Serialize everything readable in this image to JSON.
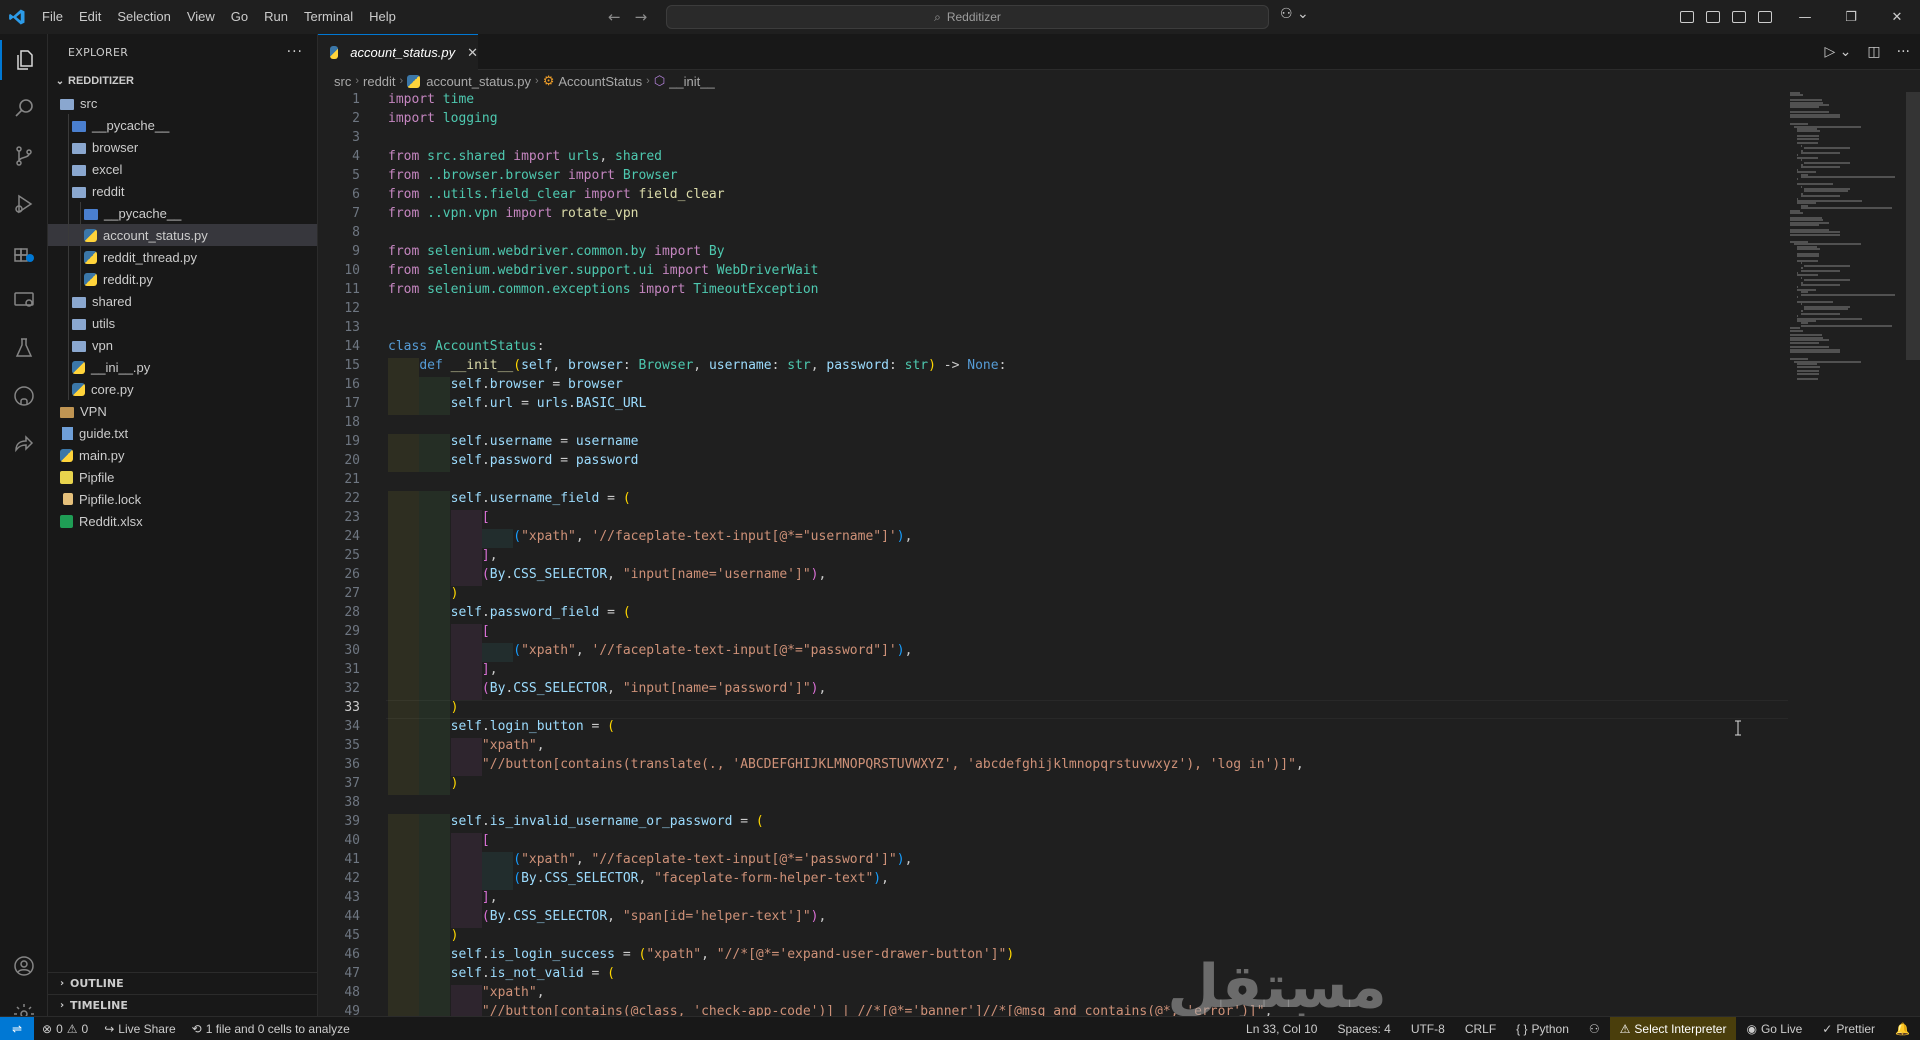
{
  "menu": [
    "File",
    "Edit",
    "Selection",
    "View",
    "Go",
    "Run",
    "Terminal",
    "Help"
  ],
  "command_center": "Redditizer",
  "explorer": {
    "title": "EXPLORER",
    "root": "REDDITIZER",
    "items": [
      {
        "label": "src",
        "depth": 0,
        "type": "folder-open"
      },
      {
        "label": "__pycache__",
        "depth": 1,
        "type": "folder-py"
      },
      {
        "label": "browser",
        "depth": 1,
        "type": "folder"
      },
      {
        "label": "excel",
        "depth": 1,
        "type": "folder"
      },
      {
        "label": "reddit",
        "depth": 1,
        "type": "folder-open"
      },
      {
        "label": "__pycache__",
        "depth": 2,
        "type": "folder-py"
      },
      {
        "label": "account_status.py",
        "depth": 2,
        "type": "py",
        "selected": true
      },
      {
        "label": "reddit_thread.py",
        "depth": 2,
        "type": "py"
      },
      {
        "label": "reddit.py",
        "depth": 2,
        "type": "py"
      },
      {
        "label": "shared",
        "depth": 1,
        "type": "folder"
      },
      {
        "label": "utils",
        "depth": 1,
        "type": "folder"
      },
      {
        "label": "vpn",
        "depth": 1,
        "type": "folder"
      },
      {
        "label": "__ini__.py",
        "depth": 1,
        "type": "py"
      },
      {
        "label": "core.py",
        "depth": 1,
        "type": "py"
      },
      {
        "label": "VPN",
        "depth": 0,
        "type": "folder-closed"
      },
      {
        "label": "guide.txt",
        "depth": 0,
        "type": "txt"
      },
      {
        "label": "main.py",
        "depth": 0,
        "type": "py"
      },
      {
        "label": "Pipfile",
        "depth": 0,
        "type": "pip"
      },
      {
        "label": "Pipfile.lock",
        "depth": 0,
        "type": "lock"
      },
      {
        "label": "Reddit.xlsx",
        "depth": 0,
        "type": "xlsx"
      }
    ],
    "outline": "OUTLINE",
    "timeline": "TIMELINE"
  },
  "tab": {
    "label": "account_status.py"
  },
  "breadcrumbs": [
    "src",
    "reddit",
    "account_status.py",
    "AccountStatus",
    "__init__"
  ],
  "editor": {
    "current_line": 33,
    "lines": [
      [
        [
          "k",
          "import"
        ],
        [
          "p",
          " "
        ],
        [
          "c",
          "time"
        ]
      ],
      [
        [
          "k",
          "import"
        ],
        [
          "p",
          " "
        ],
        [
          "c",
          "logging"
        ]
      ],
      [],
      [
        [
          "k",
          "from"
        ],
        [
          "p",
          " "
        ],
        [
          "c",
          "src.shared"
        ],
        [
          "p",
          " "
        ],
        [
          "k",
          "import"
        ],
        [
          "p",
          " "
        ],
        [
          "c",
          "urls"
        ],
        [
          "p",
          ", "
        ],
        [
          "c",
          "shared"
        ]
      ],
      [
        [
          "k",
          "from"
        ],
        [
          "p",
          " "
        ],
        [
          "c",
          "..browser.browser"
        ],
        [
          "p",
          " "
        ],
        [
          "k",
          "import"
        ],
        [
          "p",
          " "
        ],
        [
          "c",
          "Browser"
        ]
      ],
      [
        [
          "k",
          "from"
        ],
        [
          "p",
          " "
        ],
        [
          "c",
          "..utils.field_clear"
        ],
        [
          "p",
          " "
        ],
        [
          "k",
          "import"
        ],
        [
          "p",
          " "
        ],
        [
          "f",
          "field_clear"
        ]
      ],
      [
        [
          "k",
          "from"
        ],
        [
          "p",
          " "
        ],
        [
          "c",
          "..vpn.vpn"
        ],
        [
          "p",
          " "
        ],
        [
          "k",
          "import"
        ],
        [
          "p",
          " "
        ],
        [
          "f",
          "rotate_vpn"
        ]
      ],
      [],
      [
        [
          "k",
          "from"
        ],
        [
          "p",
          " "
        ],
        [
          "c",
          "selenium.webdriver.common.by"
        ],
        [
          "p",
          " "
        ],
        [
          "k",
          "import"
        ],
        [
          "p",
          " "
        ],
        [
          "c",
          "By"
        ]
      ],
      [
        [
          "k",
          "from"
        ],
        [
          "p",
          " "
        ],
        [
          "c",
          "selenium.webdriver.support.ui"
        ],
        [
          "p",
          " "
        ],
        [
          "k",
          "import"
        ],
        [
          "p",
          " "
        ],
        [
          "c",
          "WebDriverWait"
        ]
      ],
      [
        [
          "k",
          "from"
        ],
        [
          "p",
          " "
        ],
        [
          "c",
          "selenium.common.exceptions"
        ],
        [
          "p",
          " "
        ],
        [
          "k",
          "import"
        ],
        [
          "p",
          " "
        ],
        [
          "c",
          "TimeoutException"
        ]
      ],
      [],
      [],
      [
        [
          "kb",
          "class"
        ],
        [
          "p",
          " "
        ],
        [
          "c",
          "AccountStatus"
        ],
        [
          "p",
          ":"
        ]
      ],
      [
        [
          "p",
          "    "
        ],
        [
          "kb",
          "def"
        ],
        [
          "p",
          " "
        ],
        [
          "f",
          "__init__"
        ],
        [
          "br1",
          "("
        ],
        [
          "n",
          "self"
        ],
        [
          "p",
          ", "
        ],
        [
          "n",
          "browser"
        ],
        [
          "p",
          ": "
        ],
        [
          "c",
          "Browser"
        ],
        [
          "p",
          ", "
        ],
        [
          "n",
          "username"
        ],
        [
          "p",
          ": "
        ],
        [
          "c",
          "str"
        ],
        [
          "p",
          ", "
        ],
        [
          "n",
          "password"
        ],
        [
          "p",
          ": "
        ],
        [
          "c",
          "str"
        ],
        [
          "br1",
          ")"
        ],
        [
          "p",
          " -> "
        ],
        [
          "kb",
          "None"
        ],
        [
          "p",
          ":"
        ]
      ],
      [
        [
          "p",
          "        "
        ],
        [
          "n",
          "self"
        ],
        [
          "p",
          "."
        ],
        [
          "n",
          "browser"
        ],
        [
          "p",
          " = "
        ],
        [
          "n",
          "browser"
        ]
      ],
      [
        [
          "p",
          "        "
        ],
        [
          "n",
          "self"
        ],
        [
          "p",
          "."
        ],
        [
          "n",
          "url"
        ],
        [
          "p",
          " = "
        ],
        [
          "n",
          "urls"
        ],
        [
          "p",
          "."
        ],
        [
          "n",
          "BASIC_URL"
        ]
      ],
      [],
      [
        [
          "p",
          "        "
        ],
        [
          "n",
          "self"
        ],
        [
          "p",
          "."
        ],
        [
          "n",
          "username"
        ],
        [
          "p",
          " = "
        ],
        [
          "n",
          "username"
        ]
      ],
      [
        [
          "p",
          "        "
        ],
        [
          "n",
          "self"
        ],
        [
          "p",
          "."
        ],
        [
          "n",
          "password"
        ],
        [
          "p",
          " = "
        ],
        [
          "n",
          "password"
        ]
      ],
      [],
      [
        [
          "p",
          "        "
        ],
        [
          "n",
          "self"
        ],
        [
          "p",
          "."
        ],
        [
          "n",
          "username_field"
        ],
        [
          "p",
          " = "
        ],
        [
          "br1",
          "("
        ]
      ],
      [
        [
          "p",
          "            "
        ],
        [
          "br2",
          "["
        ]
      ],
      [
        [
          "p",
          "                "
        ],
        [
          "br3",
          "("
        ],
        [
          "s",
          "\"xpath\""
        ],
        [
          "p",
          ", "
        ],
        [
          "s",
          "'//faceplate-text-input[@*=\"username\"]'"
        ],
        [
          "br3",
          ")"
        ],
        [
          "p",
          ","
        ]
      ],
      [
        [
          "p",
          "            "
        ],
        [
          "br2",
          "]"
        ],
        [
          "p",
          ","
        ]
      ],
      [
        [
          "p",
          "            "
        ],
        [
          "br2",
          "("
        ],
        [
          "n",
          "By"
        ],
        [
          "p",
          "."
        ],
        [
          "n",
          "CSS_SELECTOR"
        ],
        [
          "p",
          ", "
        ],
        [
          "s",
          "\"input[name='username']\""
        ],
        [
          "br2",
          ")"
        ],
        [
          "p",
          ","
        ]
      ],
      [
        [
          "p",
          "        "
        ],
        [
          "br1",
          ")"
        ]
      ],
      [
        [
          "p",
          "        "
        ],
        [
          "n",
          "self"
        ],
        [
          "p",
          "."
        ],
        [
          "n",
          "password_field"
        ],
        [
          "p",
          " = "
        ],
        [
          "br1",
          "("
        ]
      ],
      [
        [
          "p",
          "            "
        ],
        [
          "br2",
          "["
        ]
      ],
      [
        [
          "p",
          "                "
        ],
        [
          "br3",
          "("
        ],
        [
          "s",
          "\"xpath\""
        ],
        [
          "p",
          ", "
        ],
        [
          "s",
          "'//faceplate-text-input[@*=\"password\"]'"
        ],
        [
          "br3",
          ")"
        ],
        [
          "p",
          ","
        ]
      ],
      [
        [
          "p",
          "            "
        ],
        [
          "br2",
          "]"
        ],
        [
          "p",
          ","
        ]
      ],
      [
        [
          "p",
          "            "
        ],
        [
          "br2",
          "("
        ],
        [
          "n",
          "By"
        ],
        [
          "p",
          "."
        ],
        [
          "n",
          "CSS_SELECTOR"
        ],
        [
          "p",
          ", "
        ],
        [
          "s",
          "\"input[name='password']\""
        ],
        [
          "br2",
          ")"
        ],
        [
          "p",
          ","
        ]
      ],
      [
        [
          "p",
          "        "
        ],
        [
          "br1",
          ")"
        ]
      ],
      [
        [
          "p",
          "        "
        ],
        [
          "n",
          "self"
        ],
        [
          "p",
          "."
        ],
        [
          "n",
          "login_button"
        ],
        [
          "p",
          " = "
        ],
        [
          "br1",
          "("
        ]
      ],
      [
        [
          "p",
          "            "
        ],
        [
          "s",
          "\"xpath\""
        ],
        [
          "p",
          ","
        ]
      ],
      [
        [
          "p",
          "            "
        ],
        [
          "s",
          "\"//button[contains(translate(., 'ABCDEFGHIJKLMNOPQRSTUVWXYZ', 'abcdefghijklmnopqrstuvwxyz'), 'log in')]\""
        ],
        [
          "p",
          ","
        ]
      ],
      [
        [
          "p",
          "        "
        ],
        [
          "br1",
          ")"
        ]
      ],
      [],
      [
        [
          "p",
          "        "
        ],
        [
          "n",
          "self"
        ],
        [
          "p",
          "."
        ],
        [
          "n",
          "is_invalid_username_or_password"
        ],
        [
          "p",
          " = "
        ],
        [
          "br1",
          "("
        ]
      ],
      [
        [
          "p",
          "            "
        ],
        [
          "br2",
          "["
        ]
      ],
      [
        [
          "p",
          "                "
        ],
        [
          "br3",
          "("
        ],
        [
          "s",
          "\"xpath\""
        ],
        [
          "p",
          ", "
        ],
        [
          "s",
          "\"//faceplate-text-input[@*='password']\""
        ],
        [
          "br3",
          ")"
        ],
        [
          "p",
          ","
        ]
      ],
      [
        [
          "p",
          "                "
        ],
        [
          "br3",
          "("
        ],
        [
          "n",
          "By"
        ],
        [
          "p",
          "."
        ],
        [
          "n",
          "CSS_SELECTOR"
        ],
        [
          "p",
          ", "
        ],
        [
          "s",
          "\"faceplate-form-helper-text\""
        ],
        [
          "br3",
          ")"
        ],
        [
          "p",
          ","
        ]
      ],
      [
        [
          "p",
          "            "
        ],
        [
          "br2",
          "]"
        ],
        [
          "p",
          ","
        ]
      ],
      [
        [
          "p",
          "            "
        ],
        [
          "br2",
          "("
        ],
        [
          "n",
          "By"
        ],
        [
          "p",
          "."
        ],
        [
          "n",
          "CSS_SELECTOR"
        ],
        [
          "p",
          ", "
        ],
        [
          "s",
          "\"span[id='helper-text']\""
        ],
        [
          "br2",
          ")"
        ],
        [
          "p",
          ","
        ]
      ],
      [
        [
          "p",
          "        "
        ],
        [
          "br1",
          ")"
        ]
      ],
      [
        [
          "p",
          "        "
        ],
        [
          "n",
          "self"
        ],
        [
          "p",
          "."
        ],
        [
          "n",
          "is_login_success"
        ],
        [
          "p",
          " = "
        ],
        [
          "br1",
          "("
        ],
        [
          "s",
          "\"xpath\""
        ],
        [
          "p",
          ", "
        ],
        [
          "s",
          "\"//*[@*='expand-user-drawer-button']\""
        ],
        [
          "br1",
          ")"
        ]
      ],
      [
        [
          "p",
          "        "
        ],
        [
          "n",
          "self"
        ],
        [
          "p",
          "."
        ],
        [
          "n",
          "is_not_valid"
        ],
        [
          "p",
          " = "
        ],
        [
          "br1",
          "("
        ]
      ],
      [
        [
          "p",
          "            "
        ],
        [
          "s",
          "\"xpath\""
        ],
        [
          "p",
          ","
        ]
      ],
      [
        [
          "p",
          "            "
        ],
        [
          "s",
          "\"//button[contains(@class, 'check-app-code')] | //*[@*='banner']//*[@msg and contains(@*, 'error')]\""
        ],
        [
          "p",
          ","
        ]
      ]
    ]
  },
  "watermark": {
    "arabic": "مستقل",
    "latin": "mostaql.com"
  },
  "status": {
    "errors": "0",
    "warnings": "0",
    "live_share": "Live Share",
    "analyze": "1 file and 0 cells to analyze",
    "position": "Ln 33, Col 10",
    "spaces": "Spaces: 4",
    "encoding": "UTF-8",
    "eol": "CRLF",
    "language": "Python",
    "interpreter": "Select Interpreter",
    "golive": "Go Live",
    "prettier": "Prettier"
  },
  "colors": {
    "accent": "#0078d4",
    "background": "#1f1f1f",
    "sidebar": "#181818"
  }
}
